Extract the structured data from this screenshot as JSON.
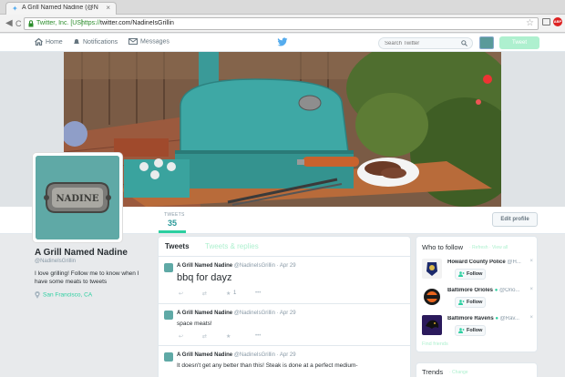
{
  "browser": {
    "tab_title": "A Grill Named Nadine (@N",
    "tab_close": "×",
    "ev_name": "Twitter, Inc. [US]",
    "url_scheme": "https://",
    "url_rest": "twitter.com/NadineIsGrillin",
    "back": "◀",
    "forward": "▶",
    "reload": "C",
    "abp_label": "ABP"
  },
  "twitter_nav": {
    "home": "Home",
    "notifications": "Notifications",
    "messages": "Messages",
    "search_placeholder": "Search Twitter",
    "tweet_button": "Tweet",
    "accent": "#2ccfa0",
    "brand": "#55acee"
  },
  "profile": {
    "name": "A Grill Named Nadine",
    "handle": "@NadineIsGrillin",
    "bio": "I love grilling! Follow me to know when I have some meats to tweets",
    "location": "San Francisco, CA",
    "plate_text": "NADINE",
    "tweets_label": "TWEETS",
    "tweets_count": "35",
    "edit_profile": "Edit profile"
  },
  "timeline": {
    "tab_tweets": "Tweets",
    "tab_replies": "Tweets & replies",
    "tweets": [
      {
        "name": "A Grill Named Nadine",
        "handle": "@NadineIsGrillin · Apr 29",
        "text": "bbq for dayz",
        "likes": "1"
      },
      {
        "name": "A Grill Named Nadine",
        "handle": "@NadineIsGrillin · Apr 29",
        "text": "space meats!"
      },
      {
        "name": "A Grill Named Nadine",
        "handle": "@NadineIsGrillin · Apr 29",
        "text": "It doesn't get any better than this! Steak is done at a perfect medium-"
      }
    ]
  },
  "who_to_follow": {
    "title": "Who to follow",
    "links": "· Refresh · View all",
    "follow_label": "Follow",
    "close": "×",
    "accounts": [
      {
        "name": "Howard County Police",
        "handle": "@H..."
      },
      {
        "name": "Baltimore Orioles",
        "handle": "@Orio..."
      },
      {
        "name": "Baltimore Ravens",
        "handle": "@Rav..."
      }
    ],
    "find_friends": "Find friends"
  },
  "trends": {
    "title": "Trends",
    "link": "· Change"
  }
}
